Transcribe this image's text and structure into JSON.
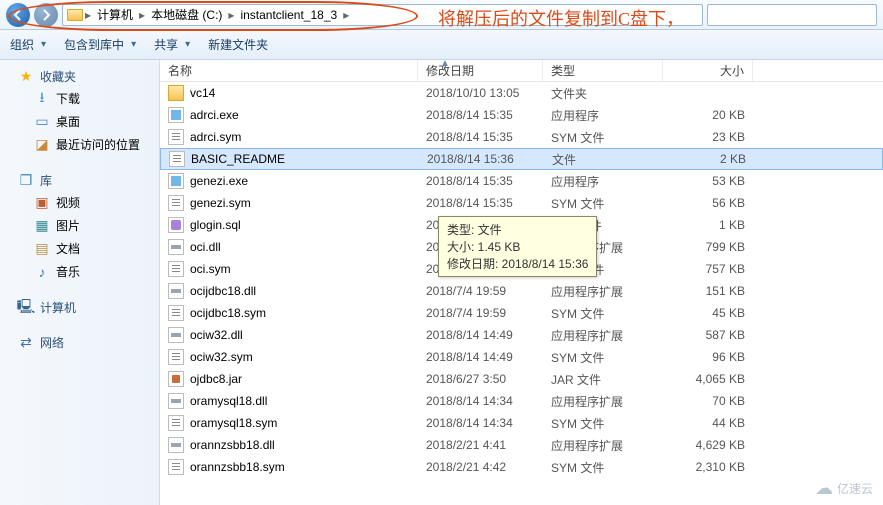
{
  "address": {
    "crumbs": [
      "计算机",
      "本地磁盘 (C:)",
      "instantclient_18_3"
    ]
  },
  "overlay_note": "将解压后的文件复制到C盘下，",
  "toolbar": {
    "organize": "组织",
    "include": "包含到库中",
    "share": "共享",
    "new_folder": "新建文件夹"
  },
  "sidebar": {
    "favorites": {
      "label": "收藏夹",
      "items": [
        {
          "label": "下载",
          "icon": "dl"
        },
        {
          "label": "桌面",
          "icon": "desk"
        },
        {
          "label": "最近访问的位置",
          "icon": "recent"
        }
      ]
    },
    "libraries": {
      "label": "库",
      "items": [
        {
          "label": "视频",
          "icon": "vid"
        },
        {
          "label": "图片",
          "icon": "pic"
        },
        {
          "label": "文档",
          "icon": "doc"
        },
        {
          "label": "音乐",
          "icon": "music"
        }
      ]
    },
    "computer": {
      "label": "计算机"
    },
    "network": {
      "label": "网络"
    }
  },
  "columns": {
    "name": "名称",
    "date": "修改日期",
    "type": "类型",
    "size": "大小"
  },
  "files": [
    {
      "name": "vc14",
      "date": "2018/10/10 13:05",
      "type": "文件夹",
      "size": "",
      "ico": "folder"
    },
    {
      "name": "adrci.exe",
      "date": "2018/8/14 15:35",
      "type": "应用程序",
      "size": "20 KB",
      "ico": "exe"
    },
    {
      "name": "adrci.sym",
      "date": "2018/8/14 15:35",
      "type": "SYM 文件",
      "size": "23 KB",
      "ico": "txt"
    },
    {
      "name": "BASIC_README",
      "date": "2018/8/14 15:36",
      "type": "文件",
      "size": "2 KB",
      "ico": "txt",
      "selected": true
    },
    {
      "name": "genezi.exe",
      "date": "2018/8/14 15:35",
      "type": "应用程序",
      "size": "53 KB",
      "ico": "exe"
    },
    {
      "name": "genezi.sym",
      "date": "2018/8/14 15:35",
      "type": "SYM 文件",
      "size": "56 KB",
      "ico": "txt"
    },
    {
      "name": "glogin.sql",
      "date": "2006/1/13 14:36",
      "type": "SQL 文件",
      "size": "1 KB",
      "ico": "sql"
    },
    {
      "name": "oci.dll",
      "date": "2018/8/14 15:27",
      "type": "应用程序扩展",
      "size": "799 KB",
      "ico": "dll"
    },
    {
      "name": "oci.sym",
      "date": "2018/8/14 15:27",
      "type": "SYM 文件",
      "size": "757 KB",
      "ico": "txt"
    },
    {
      "name": "ocijdbc18.dll",
      "date": "2018/7/4 19:59",
      "type": "应用程序扩展",
      "size": "151 KB",
      "ico": "dll"
    },
    {
      "name": "ocijdbc18.sym",
      "date": "2018/7/4 19:59",
      "type": "SYM 文件",
      "size": "45 KB",
      "ico": "txt"
    },
    {
      "name": "ociw32.dll",
      "date": "2018/8/14 14:49",
      "type": "应用程序扩展",
      "size": "587 KB",
      "ico": "dll"
    },
    {
      "name": "ociw32.sym",
      "date": "2018/8/14 14:49",
      "type": "SYM 文件",
      "size": "96 KB",
      "ico": "txt"
    },
    {
      "name": "ojdbc8.jar",
      "date": "2018/6/27 3:50",
      "type": "JAR 文件",
      "size": "4,065 KB",
      "ico": "jar"
    },
    {
      "name": "oramysql18.dll",
      "date": "2018/8/14 14:34",
      "type": "应用程序扩展",
      "size": "70 KB",
      "ico": "dll"
    },
    {
      "name": "oramysql18.sym",
      "date": "2018/8/14 14:34",
      "type": "SYM 文件",
      "size": "44 KB",
      "ico": "txt"
    },
    {
      "name": "orannzsbb18.dll",
      "date": "2018/2/21 4:41",
      "type": "应用程序扩展",
      "size": "4,629 KB",
      "ico": "dll"
    },
    {
      "name": "orannzsbb18.sym",
      "date": "2018/2/21 4:42",
      "type": "SYM 文件",
      "size": "2,310 KB",
      "ico": "txt"
    }
  ],
  "tooltip": {
    "l1": "类型: 文件",
    "l2": "大小: 1.45 KB",
    "l3": "修改日期: 2018/8/14 15:36"
  },
  "watermark": "亿速云"
}
